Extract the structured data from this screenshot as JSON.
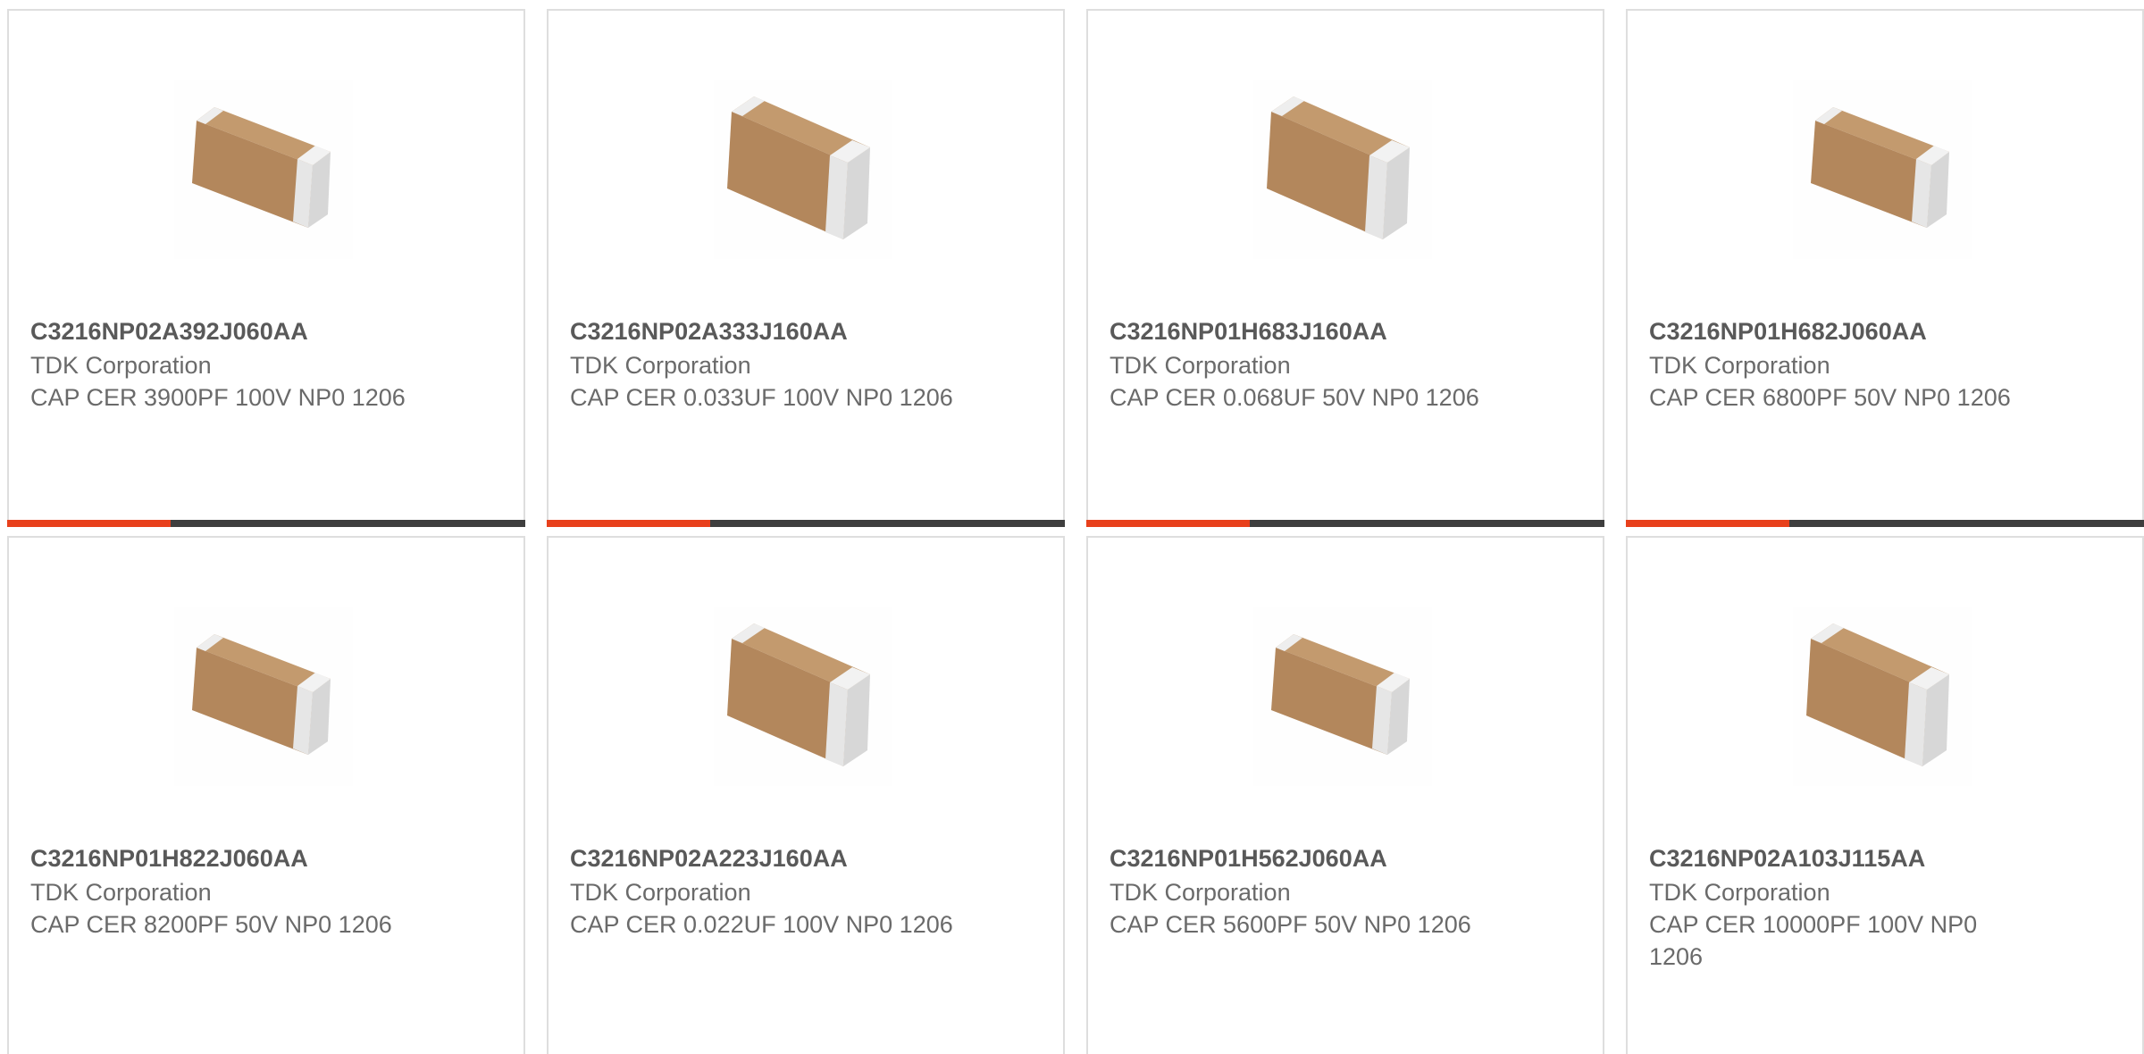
{
  "colors": {
    "accent": "#e8401c",
    "bar_dark": "#3e3e3e",
    "ceramic_body": "#b98a5f",
    "terminal": "#dcdcdc"
  },
  "products": [
    {
      "part_number": "C3216NP02A392J060AA",
      "manufacturer": "TDK Corporation",
      "description": "CAP CER 3900PF 100V NP0 1206",
      "image_icon": "smd-capacitor-icon"
    },
    {
      "part_number": "C3216NP02A333J160AA",
      "manufacturer": "TDK Corporation",
      "description": "CAP CER 0.033UF 100V NP0 1206",
      "image_icon": "smd-capacitor-icon"
    },
    {
      "part_number": "C3216NP01H683J160AA",
      "manufacturer": "TDK Corporation",
      "description": "CAP CER 0.068UF 50V NP0 1206",
      "image_icon": "smd-capacitor-icon"
    },
    {
      "part_number": "C3216NP01H682J060AA",
      "manufacturer": "TDK Corporation",
      "description": "CAP CER 6800PF 50V NP0 1206",
      "image_icon": "smd-capacitor-icon"
    },
    {
      "part_number": "C3216NP01H822J060AA",
      "manufacturer": "TDK Corporation",
      "description": "CAP CER 8200PF 50V NP0 1206",
      "image_icon": "smd-capacitor-icon"
    },
    {
      "part_number": "C3216NP02A223J160AA",
      "manufacturer": "TDK Corporation",
      "description": "CAP CER 0.022UF 100V NP0 1206",
      "image_icon": "smd-capacitor-icon"
    },
    {
      "part_number": "C3216NP01H562J060AA",
      "manufacturer": "TDK Corporation",
      "description": "CAP CER 5600PF 50V NP0 1206",
      "image_icon": "smd-capacitor-icon"
    },
    {
      "part_number": "C3216NP02A103J115AA",
      "manufacturer": "TDK Corporation",
      "description": "CAP CER 10000PF 100V NP0 1206",
      "image_icon": "smd-capacitor-icon"
    }
  ]
}
